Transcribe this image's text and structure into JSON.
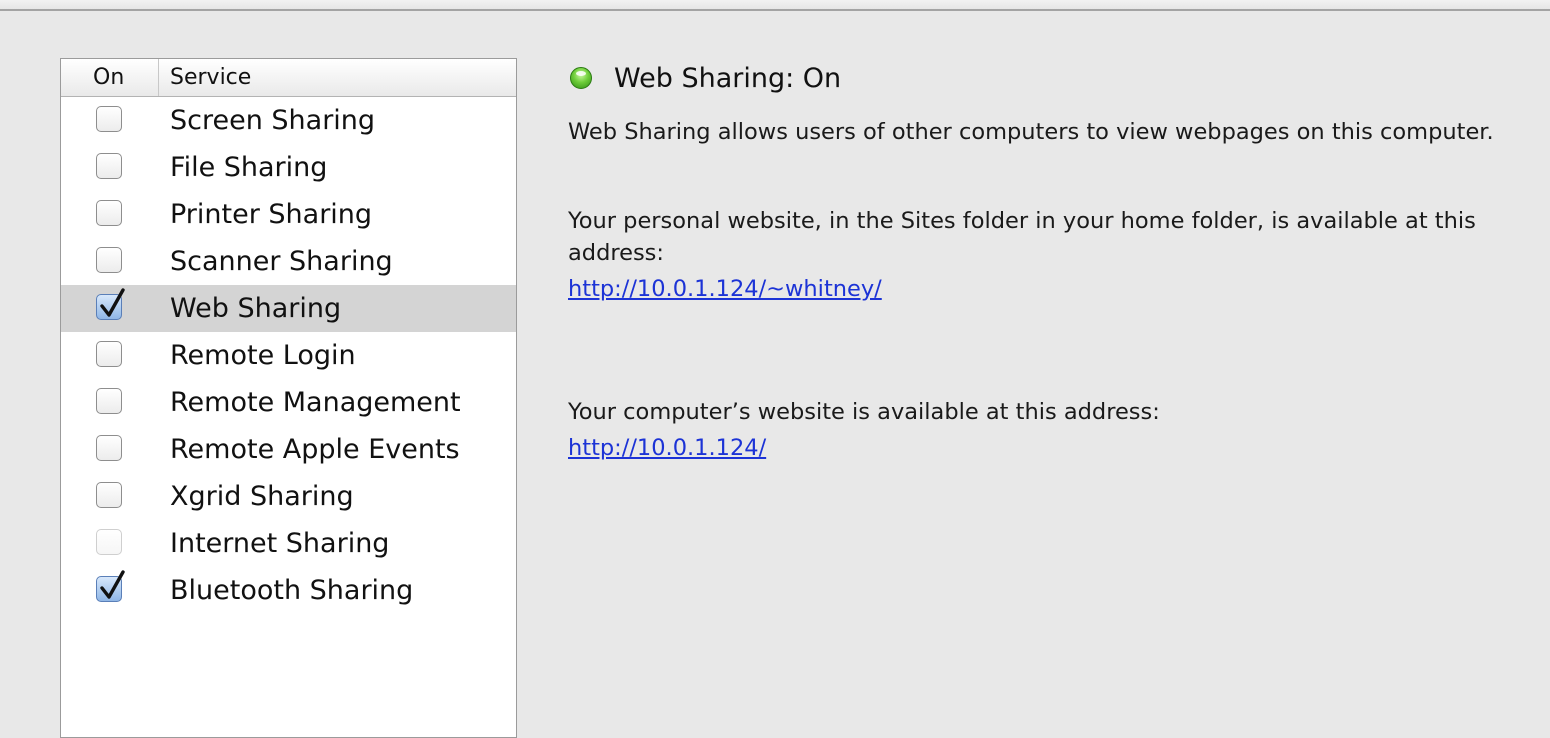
{
  "table": {
    "col_on": "On",
    "col_service": "Service",
    "services": [
      {
        "label": "Screen Sharing",
        "checked": false,
        "enabled": true,
        "selected": false
      },
      {
        "label": "File Sharing",
        "checked": false,
        "enabled": true,
        "selected": false
      },
      {
        "label": "Printer Sharing",
        "checked": false,
        "enabled": true,
        "selected": false
      },
      {
        "label": "Scanner Sharing",
        "checked": false,
        "enabled": true,
        "selected": false
      },
      {
        "label": "Web Sharing",
        "checked": true,
        "enabled": true,
        "selected": true
      },
      {
        "label": "Remote Login",
        "checked": false,
        "enabled": true,
        "selected": false
      },
      {
        "label": "Remote Management",
        "checked": false,
        "enabled": true,
        "selected": false
      },
      {
        "label": "Remote Apple Events",
        "checked": false,
        "enabled": true,
        "selected": false
      },
      {
        "label": "Xgrid Sharing",
        "checked": false,
        "enabled": true,
        "selected": false
      },
      {
        "label": "Internet Sharing",
        "checked": false,
        "enabled": false,
        "selected": false
      },
      {
        "label": "Bluetooth Sharing",
        "checked": true,
        "enabled": true,
        "selected": false
      }
    ]
  },
  "detail": {
    "status_icon": "green-status-light",
    "status_color": "#5cc12c",
    "status_title": "Web Sharing: On",
    "description": "Web Sharing allows users of other computers to view webpages on this computer.",
    "personal_text": "Your personal website, in the Sites folder in your home folder, is available at this address:",
    "personal_link": "http://10.0.1.124/~whitney/",
    "computer_text": "Your computer’s website is available at this address:",
    "computer_link": "http://10.0.1.124/",
    "link_color": "#1c33d6"
  }
}
